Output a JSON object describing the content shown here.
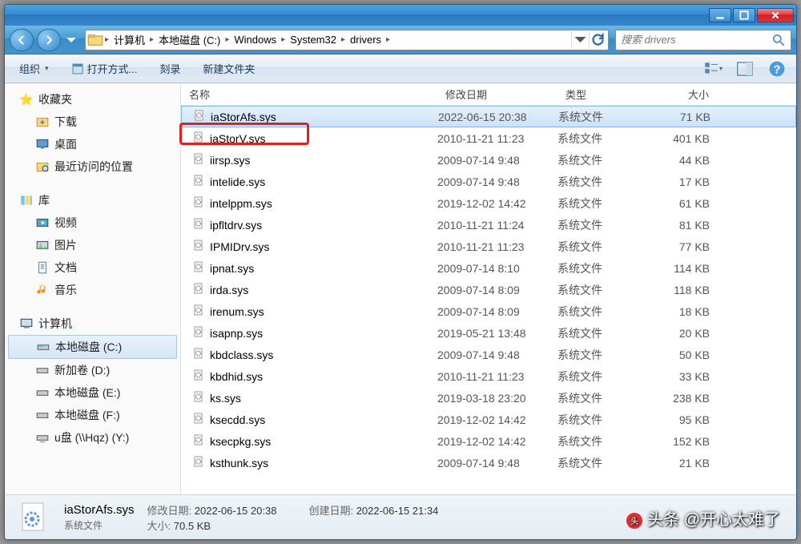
{
  "breadcrumb": [
    "计算机",
    "本地磁盘 (C:)",
    "Windows",
    "System32",
    "drivers"
  ],
  "search_placeholder": "搜索 drivers",
  "toolbar": {
    "organize": "组织",
    "openwith": "打开方式...",
    "burn": "刻录",
    "newfolder": "新建文件夹"
  },
  "sidebar": {
    "favorites": {
      "label": "收藏夹",
      "items": [
        "下载",
        "桌面",
        "最近访问的位置"
      ]
    },
    "libraries": {
      "label": "库",
      "items": [
        "视频",
        "图片",
        "文档",
        "音乐"
      ]
    },
    "computer": {
      "label": "计算机",
      "items": [
        "本地磁盘 (C:)",
        "新加卷 (D:)",
        "本地磁盘 (E:)",
        "本地磁盘 (F:)",
        "u盘 (\\\\Hqz) (Y:)"
      ]
    }
  },
  "columns": {
    "name": "名称",
    "date": "修改日期",
    "type": "类型",
    "size": "大小"
  },
  "files": [
    {
      "name": "iaStorAfs.sys",
      "date": "2022-06-15 20:38",
      "type": "系统文件",
      "size": "71 KB",
      "sel": true
    },
    {
      "name": "iaStorV.sys",
      "date": "2010-11-21 11:23",
      "type": "系统文件",
      "size": "401 KB"
    },
    {
      "name": "iirsp.sys",
      "date": "2009-07-14 9:48",
      "type": "系统文件",
      "size": "44 KB"
    },
    {
      "name": "intelide.sys",
      "date": "2009-07-14 9:48",
      "type": "系统文件",
      "size": "17 KB"
    },
    {
      "name": "intelppm.sys",
      "date": "2019-12-02 14:42",
      "type": "系统文件",
      "size": "61 KB"
    },
    {
      "name": "ipfltdrv.sys",
      "date": "2010-11-21 11:24",
      "type": "系统文件",
      "size": "81 KB"
    },
    {
      "name": "IPMIDrv.sys",
      "date": "2010-11-21 11:23",
      "type": "系统文件",
      "size": "77 KB"
    },
    {
      "name": "ipnat.sys",
      "date": "2009-07-14 8:10",
      "type": "系统文件",
      "size": "114 KB"
    },
    {
      "name": "irda.sys",
      "date": "2009-07-14 8:09",
      "type": "系统文件",
      "size": "118 KB"
    },
    {
      "name": "irenum.sys",
      "date": "2009-07-14 8:09",
      "type": "系统文件",
      "size": "18 KB"
    },
    {
      "name": "isapnp.sys",
      "date": "2019-05-21 13:48",
      "type": "系统文件",
      "size": "20 KB"
    },
    {
      "name": "kbdclass.sys",
      "date": "2009-07-14 9:48",
      "type": "系统文件",
      "size": "50 KB"
    },
    {
      "name": "kbdhid.sys",
      "date": "2010-11-21 11:23",
      "type": "系统文件",
      "size": "33 KB"
    },
    {
      "name": "ks.sys",
      "date": "2019-03-18 23:20",
      "type": "系统文件",
      "size": "238 KB"
    },
    {
      "name": "ksecdd.sys",
      "date": "2019-12-02 14:42",
      "type": "系统文件",
      "size": "95 KB"
    },
    {
      "name": "ksecpkg.sys",
      "date": "2019-12-02 14:42",
      "type": "系统文件",
      "size": "152 KB"
    },
    {
      "name": "ksthunk.sys",
      "date": "2009-07-14 9:48",
      "type": "系统文件",
      "size": "21 KB"
    }
  ],
  "status": {
    "filename": "iaStorAfs.sys",
    "filetype": "系统文件",
    "mod_label": "修改日期:",
    "mod_val": "2022-06-15 20:38",
    "create_label": "创建日期:",
    "create_val": "2022-06-15 21:34",
    "size_label": "大小:",
    "size_val": "70.5 KB"
  },
  "watermark": "头条 @开心太难了"
}
